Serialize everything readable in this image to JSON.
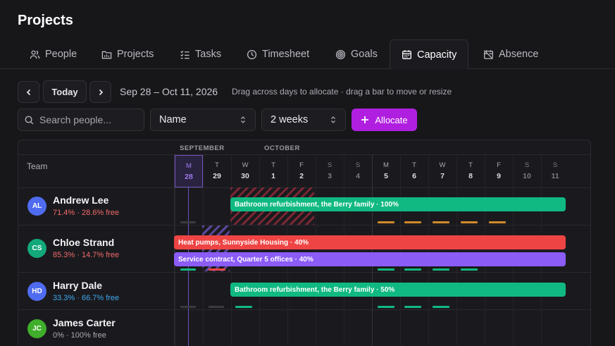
{
  "page": {
    "title": "Projects"
  },
  "tabs": [
    {
      "label": "People",
      "icon": "people-icon"
    },
    {
      "label": "Projects",
      "icon": "folder-icon"
    },
    {
      "label": "Tasks",
      "icon": "tasks-icon"
    },
    {
      "label": "Timesheet",
      "icon": "clock-icon"
    },
    {
      "label": "Goals",
      "icon": "target-icon"
    },
    {
      "label": "Capacity",
      "icon": "calendar-icon",
      "active": true
    },
    {
      "label": "Absence",
      "icon": "calendar-off-icon"
    }
  ],
  "toolbar": {
    "today_label": "Today",
    "range_text": "Sep 28 – Oct 11, 2026",
    "hint_text": "Drag across days to allocate · drag a bar to move or resize",
    "search_placeholder": "Search people...",
    "sort_value": "Name",
    "span_value": "2 weeks",
    "allocate_label": "Allocate"
  },
  "grid": {
    "team_header": "Team",
    "months": [
      "SEPTEMBER",
      "OCTOBER"
    ],
    "days": [
      {
        "letter": "M",
        "num": "28",
        "today": true
      },
      {
        "letter": "T",
        "num": "29"
      },
      {
        "letter": "W",
        "num": "30"
      },
      {
        "letter": "T",
        "num": "1"
      },
      {
        "letter": "F",
        "num": "2"
      },
      {
        "letter": "S",
        "num": "3",
        "weekend": true
      },
      {
        "letter": "S",
        "num": "4",
        "weekend": true
      },
      {
        "letter": "M",
        "num": "5"
      },
      {
        "letter": "T",
        "num": "6"
      },
      {
        "letter": "W",
        "num": "7"
      },
      {
        "letter": "T",
        "num": "8"
      },
      {
        "letter": "F",
        "num": "9"
      },
      {
        "letter": "S",
        "num": "10",
        "weekend": true
      },
      {
        "letter": "S",
        "num": "11",
        "weekend": true
      }
    ]
  },
  "people": [
    {
      "initials": "AL",
      "name": "Andrew Lee",
      "stats": "71.4% · 28.6% free",
      "avatar_color": "#4f6cf0",
      "stats_color": "#f06a6a"
    },
    {
      "initials": "CS",
      "name": "Chloe Strand",
      "stats": "85.3% · 14.7% free",
      "avatar_color": "#12a87a",
      "stats_color": "#f06a6a"
    },
    {
      "initials": "HD",
      "name": "Harry Dale",
      "stats": "33.3% · 66.7% free",
      "avatar_color": "#4f6cf0",
      "stats_color": "#3fa8f0"
    },
    {
      "initials": "JC",
      "name": "James Carter",
      "stats": "0% · 100% free",
      "avatar_color": "#3fae2a",
      "stats_color": "#a9a9b0"
    }
  ],
  "allocations": [
    {
      "label": "Bathroom refurbishment, the Berry family · 100%",
      "color": "#10b981"
    },
    {
      "label": "Heat pumps, Sunnyside Housing · 40%",
      "color": "#ef4444"
    },
    {
      "label": "Service contract, Quarter 5 offices · 40%",
      "color": "#8b5cf6"
    },
    {
      "label": "Bathroom refurbishment, the Berry family · 50%",
      "color": "#10b981"
    }
  ],
  "colors": {
    "accent": "#b01fe0",
    "today": "#7353b8",
    "ok": "#10b981",
    "warn": "#d08a2a",
    "over": "#ef4444"
  }
}
